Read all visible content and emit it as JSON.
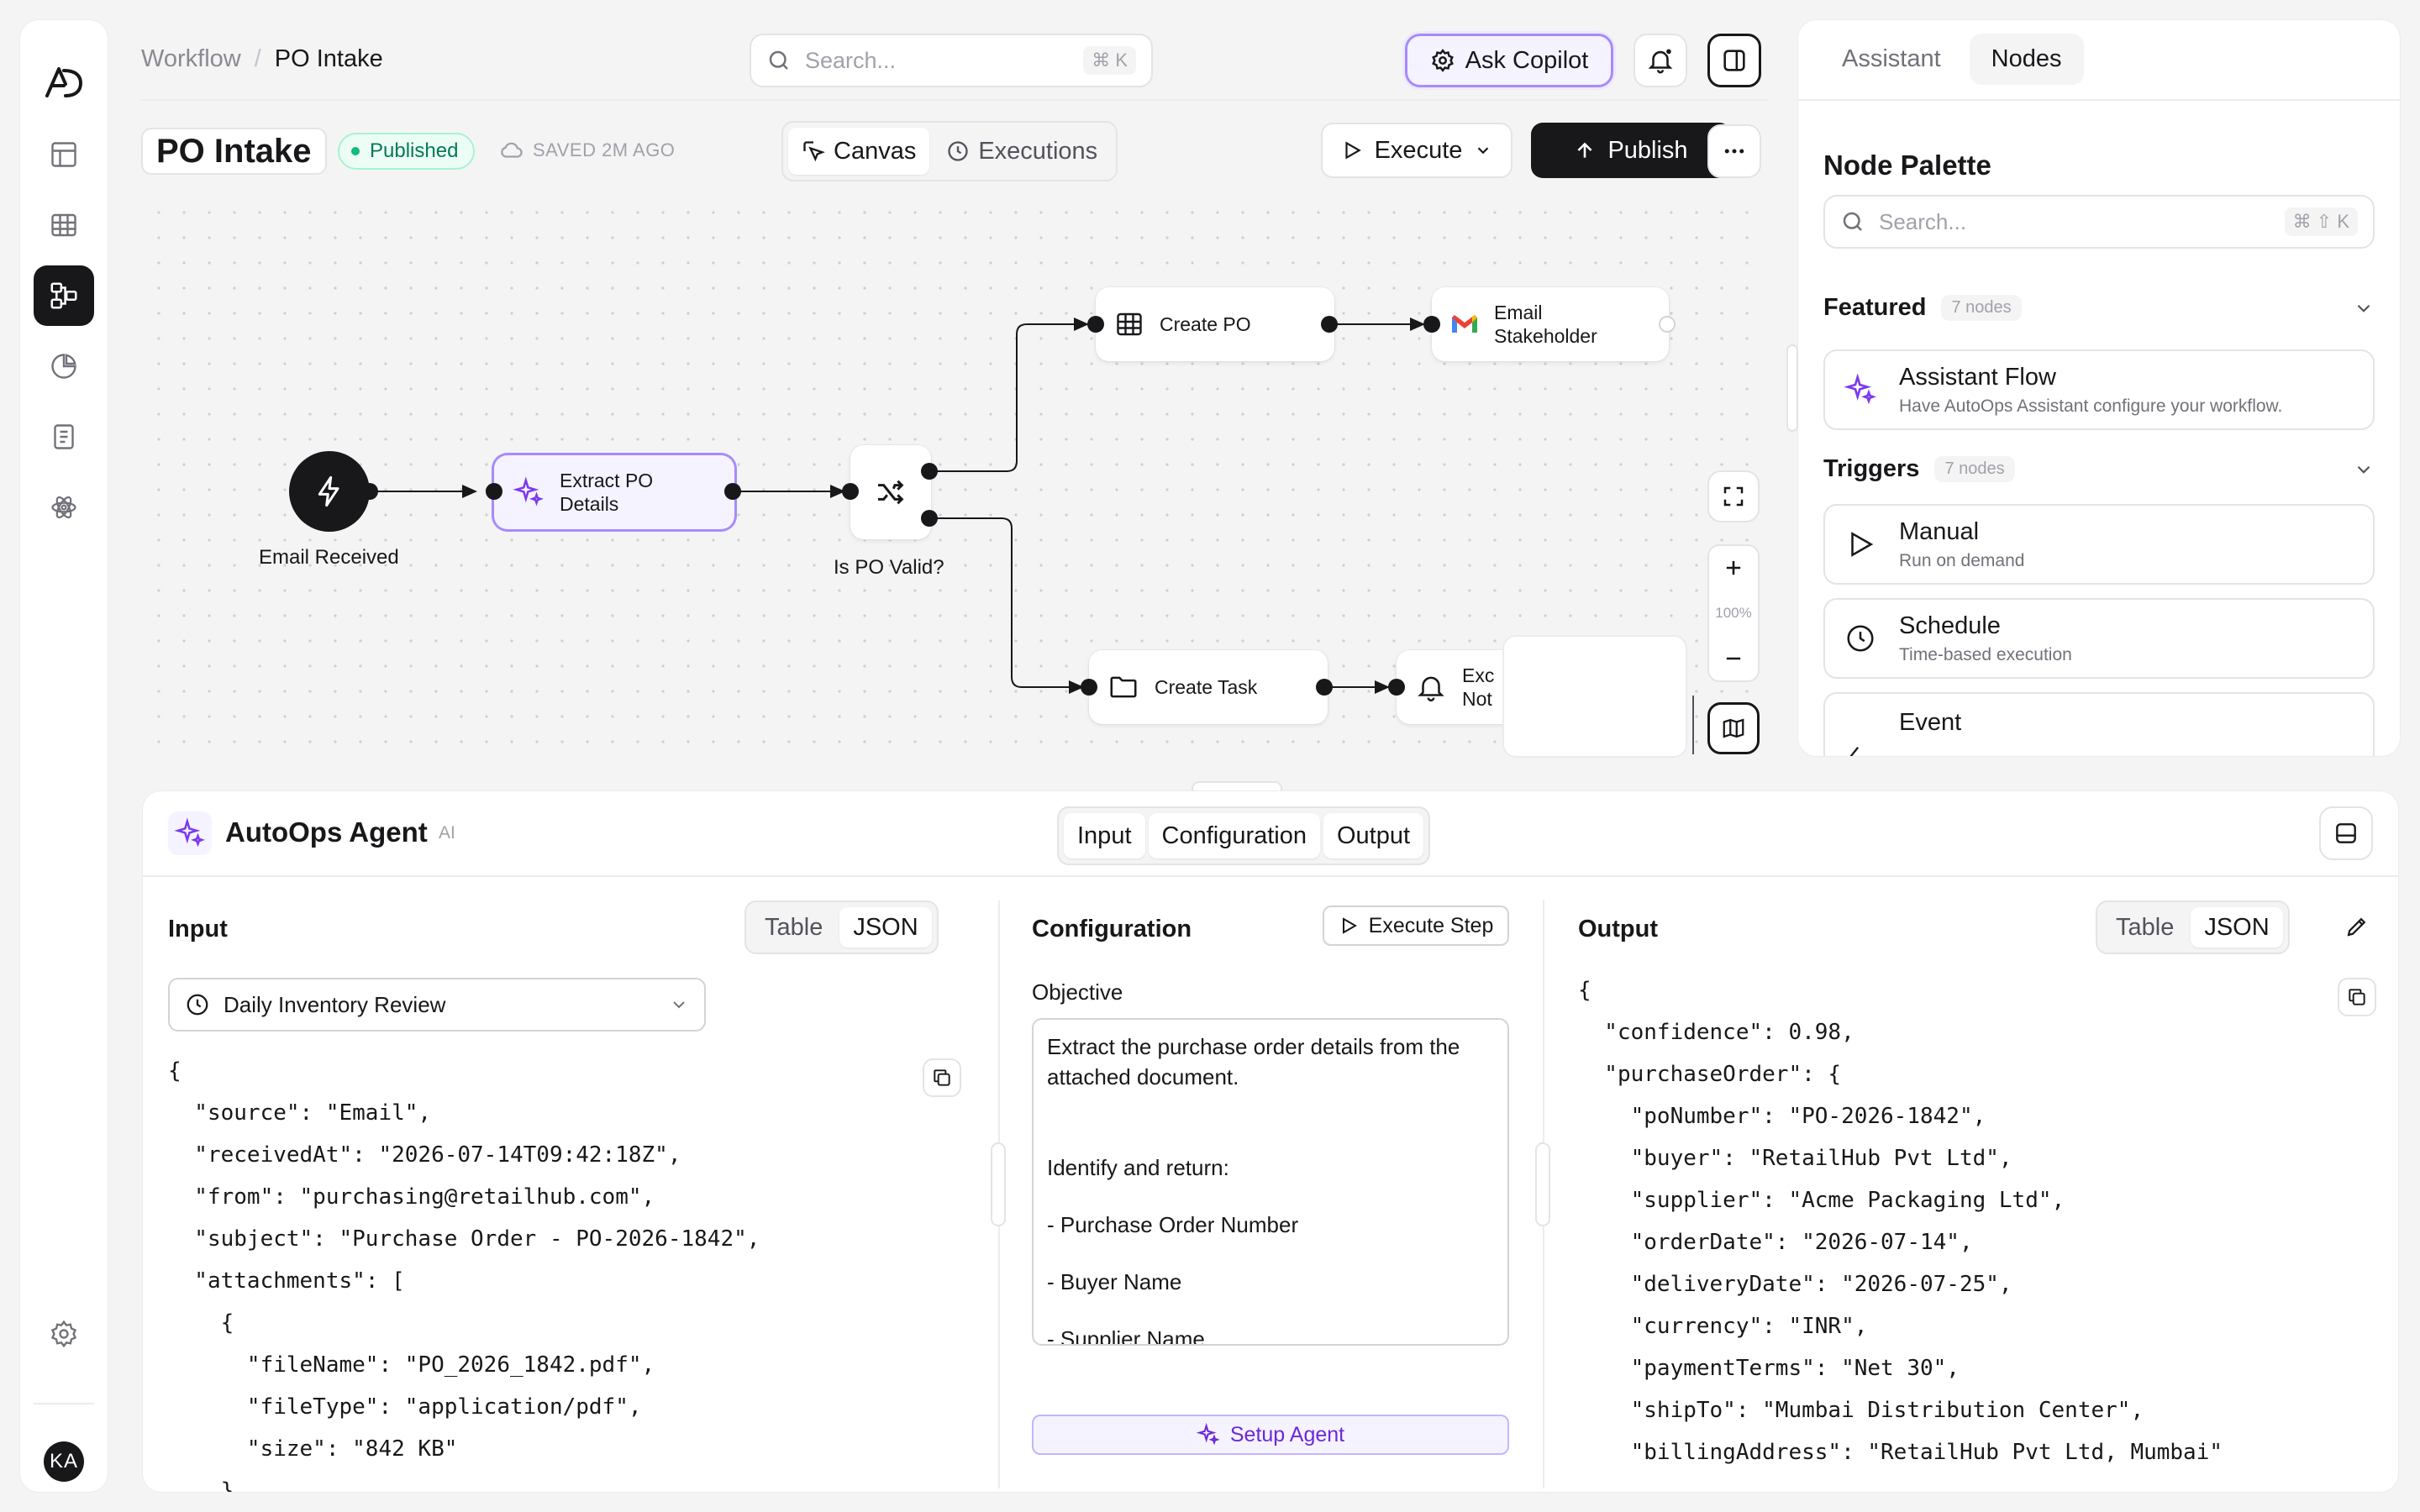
{
  "app": {
    "logo": "AD",
    "avatar": "KA"
  },
  "sidebar": {
    "items": [
      {
        "icon": "layout-icon"
      },
      {
        "icon": "table-icon"
      },
      {
        "icon": "workflow-icon",
        "active": true
      },
      {
        "icon": "pie-chart-icon"
      },
      {
        "icon": "document-icon"
      },
      {
        "icon": "atom-icon"
      }
    ],
    "bottom_icon": "settings-icon"
  },
  "header": {
    "breadcrumb": [
      "Workflow",
      "PO Intake"
    ],
    "search_placeholder": "Search...",
    "search_shortcut": "⌘ K",
    "copilot_label": "Ask Copilot"
  },
  "toolbar": {
    "title": "PO Intake",
    "status": "Published",
    "saved": "SAVED 2M AGO",
    "views": [
      "Canvas",
      "Executions"
    ],
    "active_view": "Canvas",
    "execute_label": "Execute",
    "publish_label": "Publish"
  },
  "canvas": {
    "nodes": {
      "trigger": "Email Received",
      "extract": "Extract PO Details",
      "extract_l1": "Extract PO",
      "extract_l2": "Details",
      "branch": "Is PO Valid?",
      "create_po": "Create PO",
      "email_l1": "Email",
      "email_l2": "Stakeholder",
      "create_task": "Create Task",
      "exc_l1": "Exc",
      "exc_l2": "Not"
    },
    "zoom": "100%"
  },
  "right_panel": {
    "tabs": [
      "Assistant",
      "Nodes"
    ],
    "active_tab": "Nodes",
    "title": "Node Palette",
    "search_placeholder": "Search...",
    "search_shortcut": "⌘ ⇧ K",
    "groups": [
      {
        "name": "Featured",
        "count": "7 nodes",
        "items": [
          {
            "title": "Assistant Flow",
            "desc": "Have AutoOps Assistant configure your workflow."
          }
        ]
      },
      {
        "name": "Triggers",
        "count": "7 nodes",
        "items": [
          {
            "title": "Manual",
            "desc": "Run on demand"
          },
          {
            "title": "Schedule",
            "desc": "Time-based execution"
          },
          {
            "title": "Event",
            "desc": ""
          }
        ]
      }
    ]
  },
  "bottom_panel": {
    "title": "AutoOps Agent",
    "tag": "AI",
    "tabs": [
      "Input",
      "Configuration",
      "Output"
    ],
    "input": {
      "heading": "Input",
      "formats": [
        "Table",
        "JSON"
      ],
      "active_format": "JSON",
      "source": "Daily Inventory Review",
      "json": "{\n  \"source\": \"Email\",\n  \"receivedAt\": \"2026-07-14T09:42:18Z\",\n  \"from\": \"purchasing@retailhub.com\",\n  \"subject\": \"Purchase Order - PO-2026-1842\",\n  \"attachments\": [\n    {\n      \"fileName\": \"PO_2026_1842.pdf\",\n      \"fileType\": \"application/pdf\",\n      \"size\": \"842 KB\"\n    }"
    },
    "configuration": {
      "heading": "Configuration",
      "execute_step": "Execute Step",
      "objective_label": "Objective",
      "objective_lines": [
        "Extract the purchase order details from the attached document.",
        "",
        "",
        "Identify and return:",
        "- Purchase Order Number",
        "- Buyer Name",
        "- Supplier Name"
      ],
      "setup_label": "Setup Agent"
    },
    "output": {
      "heading": "Output",
      "formats": [
        "Table",
        "JSON"
      ],
      "active_format": "JSON",
      "json": "{\n  \"confidence\": 0.98,\n  \"purchaseOrder\": {\n    \"poNumber\": \"PO-2026-1842\",\n    \"buyer\": \"RetailHub Pvt Ltd\",\n    \"supplier\": \"Acme Packaging Ltd\",\n    \"orderDate\": \"2026-07-14\",\n    \"deliveryDate\": \"2026-07-25\",\n    \"currency\": \"INR\",\n    \"paymentTerms\": \"Net 30\",\n    \"shipTo\": \"Mumbai Distribution Center\",\n    \"billingAddress\": \"RetailHub Pvt Ltd, Mumbai\""
    }
  }
}
